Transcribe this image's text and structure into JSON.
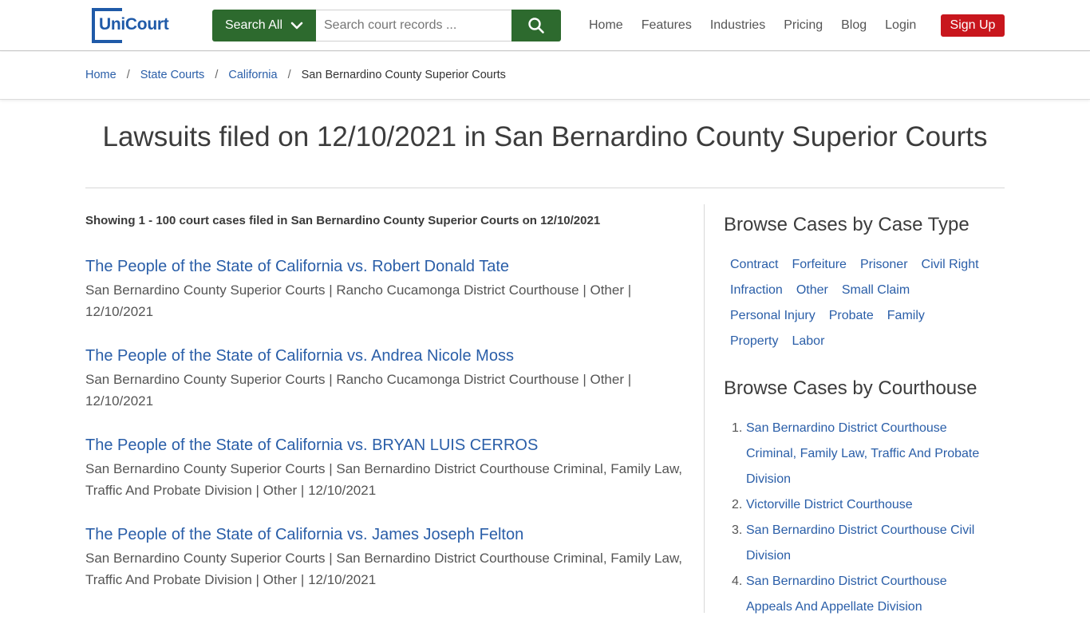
{
  "header": {
    "logo_text": "UniCourt",
    "search_scope_label": "Search All",
    "search_placeholder": "Search court records ...",
    "search_value": "",
    "nav": [
      "Home",
      "Features",
      "Industries",
      "Pricing",
      "Blog",
      "Login"
    ],
    "signup_label": "Sign Up",
    "colors": {
      "brand": "#1f5aa8",
      "search_green": "#2d6a2e",
      "signup_red": "#c8161d"
    }
  },
  "breadcrumb": {
    "items": [
      "Home",
      "State Courts",
      "California"
    ],
    "current": "San Bernardino County Superior Courts",
    "separator": "/"
  },
  "page_title": "Lawsuits filed on 12/10/2021 in San Bernardino County Superior Courts",
  "main": {
    "showing": "Showing 1 - 100 court cases filed in San Bernardino County Superior Courts on 12/10/2021",
    "cases": [
      {
        "title": "The People of the State of California vs. Robert Donald Tate",
        "meta": "San Bernardino County Superior Courts | Rancho Cucamonga District Courthouse | Other | 12/10/2021"
      },
      {
        "title": "The People of the State of California vs. Andrea Nicole Moss",
        "meta": "San Bernardino County Superior Courts | Rancho Cucamonga District Courthouse | Other | 12/10/2021"
      },
      {
        "title": "The People of the State of California vs. BRYAN LUIS CERROS",
        "meta": "San Bernardino County Superior Courts | San Bernardino District Courthouse Criminal, Family Law, Traffic And Probate Division | Other | 12/10/2021"
      },
      {
        "title": "The People of the State of California vs. James Joseph Felton",
        "meta": "San Bernardino County Superior Courts | San Bernardino District Courthouse Criminal, Family Law, Traffic And Probate Division | Other | 12/10/2021"
      }
    ]
  },
  "sidebar": {
    "case_type_heading": "Browse Cases by Case Type",
    "case_types": [
      "Contract",
      "Forfeiture",
      "Prisoner",
      "Civil Right",
      "Infraction",
      "Other",
      "Small Claim",
      "Personal Injury",
      "Probate",
      "Family",
      "Property",
      "Labor"
    ],
    "courthouse_heading": "Browse Cases by Courthouse",
    "courthouses": [
      {
        "num": "1.",
        "name": "San Bernardino District Courthouse Criminal, Family Law, Traffic And Probate Division"
      },
      {
        "num": "2.",
        "name": "Victorville District Courthouse"
      },
      {
        "num": "3.",
        "name": "San Bernardino District Courthouse Civil Division"
      },
      {
        "num": "4.",
        "name": "San Bernardino District Courthouse Appeals And Appellate Division"
      }
    ]
  }
}
